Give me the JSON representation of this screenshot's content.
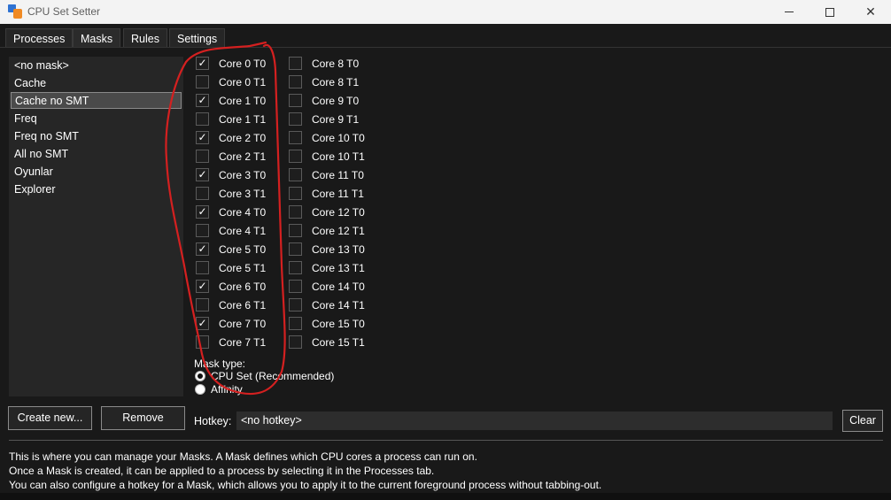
{
  "window": {
    "title": "CPU Set Setter",
    "controls": {
      "minimize": "minimize-icon",
      "maximize": "maximize-icon",
      "close": "close-icon"
    },
    "close_glyph": "✕"
  },
  "tabs": [
    {
      "label": "Processes",
      "active": false
    },
    {
      "label": "Masks",
      "active": true
    },
    {
      "label": "Rules",
      "active": false
    },
    {
      "label": "Settings",
      "active": false
    }
  ],
  "masks": {
    "items": [
      "<no mask>",
      "Cache",
      "Cache no SMT",
      "Freq",
      "Freq no SMT",
      "All no SMT",
      "Oyunlar",
      "Explorer"
    ],
    "selected": "Cache no SMT"
  },
  "cores": {
    "left": [
      {
        "label": "Core 0 T0",
        "checked": true
      },
      {
        "label": "Core 0 T1",
        "checked": false
      },
      {
        "label": "Core 1 T0",
        "checked": true
      },
      {
        "label": "Core 1 T1",
        "checked": false
      },
      {
        "label": "Core 2 T0",
        "checked": true
      },
      {
        "label": "Core 2 T1",
        "checked": false
      },
      {
        "label": "Core 3 T0",
        "checked": true
      },
      {
        "label": "Core 3 T1",
        "checked": false
      },
      {
        "label": "Core 4 T0",
        "checked": true
      },
      {
        "label": "Core 4 T1",
        "checked": false
      },
      {
        "label": "Core 5 T0",
        "checked": true
      },
      {
        "label": "Core 5 T1",
        "checked": false
      },
      {
        "label": "Core 6 T0",
        "checked": true
      },
      {
        "label": "Core 6 T1",
        "checked": false
      },
      {
        "label": "Core 7 T0",
        "checked": true
      },
      {
        "label": "Core 7 T1",
        "checked": false
      }
    ],
    "right": [
      {
        "label": "Core 8 T0",
        "checked": false
      },
      {
        "label": "Core 8 T1",
        "checked": false
      },
      {
        "label": "Core 9 T0",
        "checked": false
      },
      {
        "label": "Core 9 T1",
        "checked": false
      },
      {
        "label": "Core 10 T0",
        "checked": false
      },
      {
        "label": "Core 10 T1",
        "checked": false
      },
      {
        "label": "Core 11 T0",
        "checked": false
      },
      {
        "label": "Core 11 T1",
        "checked": false
      },
      {
        "label": "Core 12 T0",
        "checked": false
      },
      {
        "label": "Core 12 T1",
        "checked": false
      },
      {
        "label": "Core 13 T0",
        "checked": false
      },
      {
        "label": "Core 13 T1",
        "checked": false
      },
      {
        "label": "Core 14 T0",
        "checked": false
      },
      {
        "label": "Core 14 T1",
        "checked": false
      },
      {
        "label": "Core 15 T0",
        "checked": false
      },
      {
        "label": "Core 15 T1",
        "checked": false
      }
    ],
    "check_glyph": "✓"
  },
  "mask_type": {
    "label": "Mask type:",
    "options": [
      {
        "label": "CPU Set (Recommended)",
        "checked": true
      },
      {
        "label": "Affinity",
        "checked": false
      }
    ]
  },
  "buttons": {
    "create": "Create new...",
    "remove": "Remove",
    "clear": "Clear"
  },
  "hotkey": {
    "label": "Hotkey:",
    "value": "<no hotkey>"
  },
  "help_lines": [
    "This is where you can manage your Masks. A Mask defines which CPU cores a process can run on.",
    "Once a Mask is created, it can be applied to a process by selecting it in the Processes tab.",
    "You can also configure a hotkey for a Mask, which allows you to apply it to the current foreground process without tabbing-out."
  ],
  "colors": {
    "background": "#191919",
    "list_background": "#262626",
    "annotation": "#d42020",
    "titlebar": "#f3f3f3"
  }
}
